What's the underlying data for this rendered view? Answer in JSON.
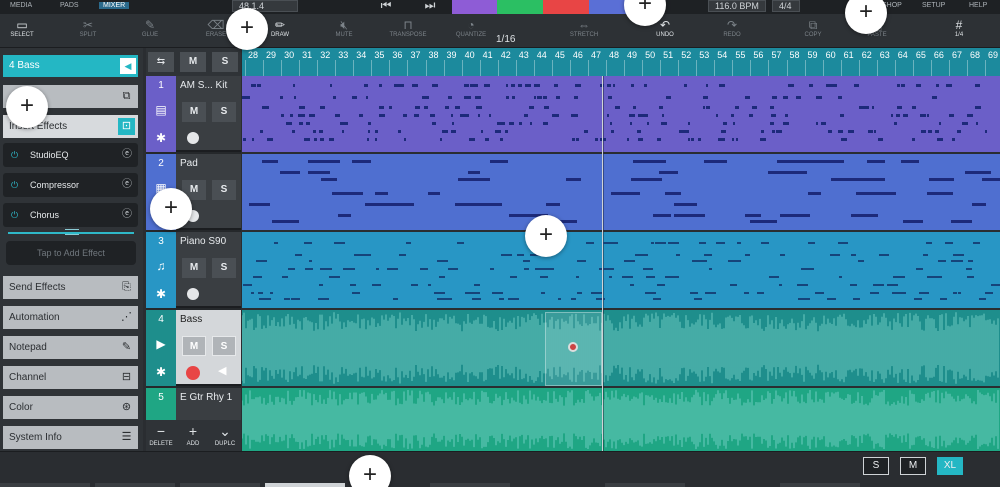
{
  "topbar": {
    "media_label": "MEDIA",
    "pads_label": "PADS",
    "mixer_label": "MIXER",
    "position": "48.1.4",
    "tempo": "116.0 BPM",
    "signature": "4/4",
    "shop_label": "SHOP",
    "setup_label": "SETUP",
    "help_label": "HELP"
  },
  "toolbar": {
    "tools": [
      {
        "label": "SELECT",
        "icon": "select-icon"
      },
      {
        "label": "SPLIT",
        "icon": "split-icon"
      },
      {
        "label": "GLUE",
        "icon": "glue-icon"
      },
      {
        "label": "ERASE",
        "icon": "erase-icon"
      },
      {
        "label": "DRAW",
        "icon": "draw-icon"
      },
      {
        "label": "MUTE",
        "icon": "mute-icon"
      },
      {
        "label": "TRANSPOSE",
        "icon": "transpose-icon"
      },
      {
        "label": "QUANTIZE",
        "icon": "quantize-icon"
      },
      {
        "label": "STRETCH",
        "icon": "stretch-icon"
      },
      {
        "label": "UNDO",
        "icon": "undo-icon"
      },
      {
        "label": "REDO",
        "icon": "redo-icon"
      },
      {
        "label": "COPY",
        "icon": "copy-icon"
      },
      {
        "label": "PASTE",
        "icon": "paste-icon"
      }
    ],
    "quantize_value": "1/16",
    "grid_value": "1/4"
  },
  "left_panel": {
    "track_header": "4  Bass",
    "insert_effects_label": "Insert Effects",
    "effects": [
      "StudioEQ",
      "Compressor",
      "Chorus"
    ],
    "tap_to_add": "Tap to Add Effect",
    "sections": [
      "Send Effects",
      "Automation",
      "Notepad",
      "Channel",
      "Color",
      "System Info"
    ]
  },
  "track_controls": {
    "mute_label": "M",
    "solo_label": "S"
  },
  "tracks": [
    {
      "num": "1",
      "name": "AM S... Kit",
      "color": "#6b5fc8"
    },
    {
      "num": "2",
      "name": "Pad",
      "color": "#4f6fd0"
    },
    {
      "num": "3",
      "name": "Piano S90",
      "color": "#2896c5"
    },
    {
      "num": "4",
      "name": "Bass",
      "color": "#1e8e8c"
    },
    {
      "num": "5",
      "name": "E Gtr Rhy 1",
      "color": "#1fa684"
    }
  ],
  "track_bottom": {
    "delete_label": "DELETE",
    "add_label": "ADD",
    "duplicate_label": "DUPLC"
  },
  "ruler": {
    "bars": [
      "28",
      "29",
      "30",
      "31",
      "32",
      "33",
      "34",
      "35",
      "36",
      "37",
      "38",
      "39",
      "40",
      "41",
      "42",
      "43",
      "44",
      "45",
      "46",
      "47",
      "48",
      "49",
      "50",
      "51",
      "52",
      "53",
      "54",
      "55",
      "56",
      "57",
      "58",
      "59",
      "60",
      "61",
      "62",
      "63",
      "64",
      "65",
      "66",
      "67",
      "68",
      "69"
    ]
  },
  "view_sizes": [
    "S",
    "M",
    "XL"
  ],
  "active_view_size": "XL",
  "colors": {
    "accent": "#24b7c4",
    "record": "#e84545",
    "play": "#2bbf63",
    "loop": "#8e5cd6"
  }
}
